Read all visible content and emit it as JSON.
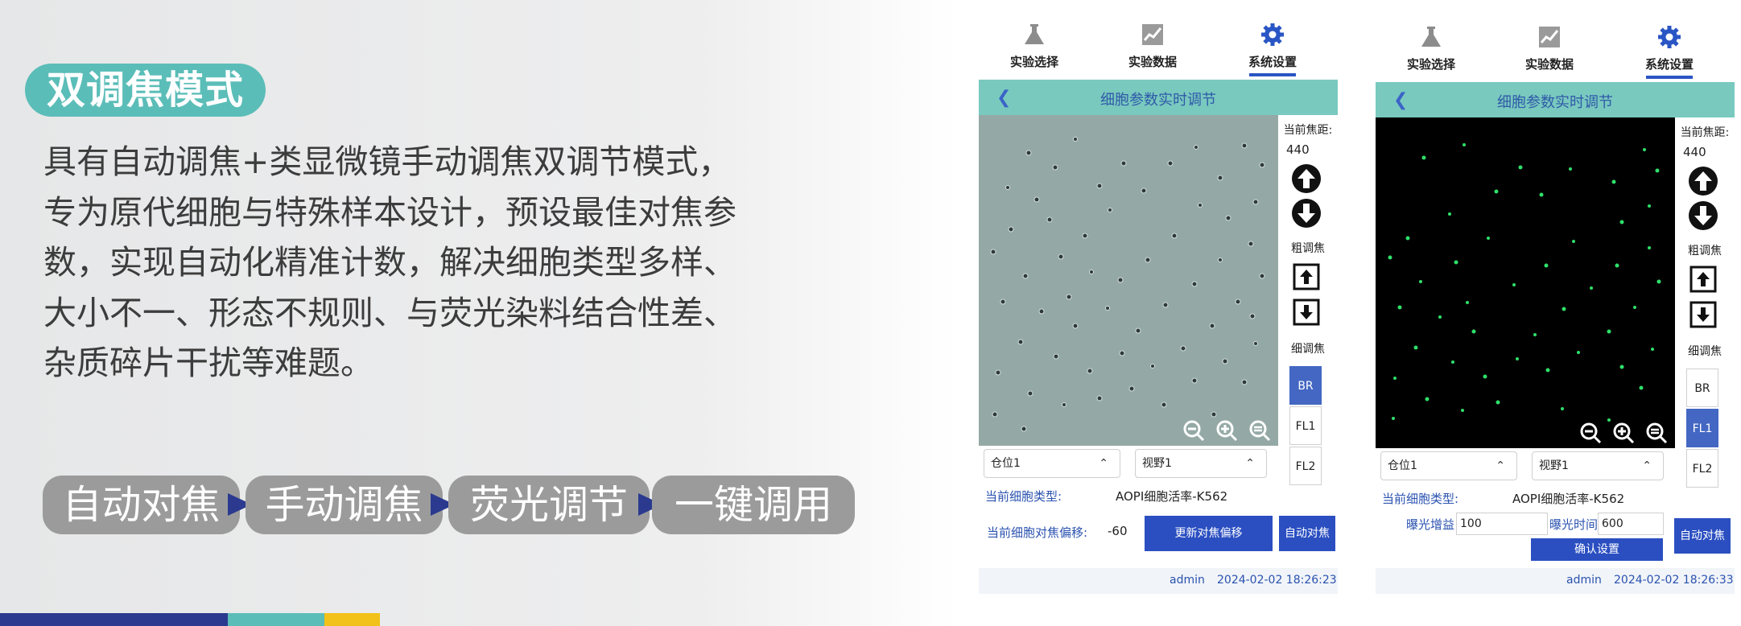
{
  "promo": {
    "mode_title": "双调焦模式",
    "description_lines": [
      "具有自动调焦+类显微镜手动调焦双调节模式，",
      "专为原代细胞与特殊样本设计，预设最佳对焦参",
      "数，实现自动化精准计数，解决细胞类型多样、",
      "大小不一、形态不规则、与荧光染料结合性差、",
      "杂质碎片干扰等难题。"
    ],
    "features": [
      "自动对焦",
      "手动调焦",
      "荧光调节",
      "一键调用"
    ],
    "colors": {
      "teal": "#5bbdb8",
      "navy": "#2b3a8f",
      "gray_pill": "#9b9b9b",
      "yellow": "#f2c11a"
    }
  },
  "nav": {
    "items": [
      {
        "label": "实验选择",
        "icon": "flask-icon"
      },
      {
        "label": "实验数据",
        "icon": "chart-icon"
      },
      {
        "label": "系统设置",
        "icon": "gear-icon",
        "active": true
      }
    ]
  },
  "screen_brightfield": {
    "header_title": "细胞参数实时调节",
    "focus_label": "当前焦距:",
    "focus_value": "440",
    "coarse_label": "粗调焦",
    "fine_label": "细调焦",
    "channels": [
      {
        "label": "BR",
        "active": true
      },
      {
        "label": "FL1",
        "active": false
      },
      {
        "label": "FL2",
        "active": false
      }
    ],
    "slot_select": "仓位1",
    "view_select": "视野1",
    "cell_type_label": "当前细胞类型:",
    "cell_type_value": "AOPI细胞活率-K562",
    "offset_label": "当前细胞对焦偏移:",
    "offset_value": "-60",
    "update_offset_button": "更新对焦偏移",
    "autofocus_button": "自动对焦",
    "user": "admin",
    "timestamp": "2024-02-02 18:26:23"
  },
  "screen_fluorescence": {
    "header_title": "细胞参数实时调节",
    "focus_label": "当前焦距:",
    "focus_value": "440",
    "coarse_label": "粗调焦",
    "fine_label": "细调焦",
    "channels": [
      {
        "label": "BR",
        "active": false
      },
      {
        "label": "FL1",
        "active": true
      },
      {
        "label": "FL2",
        "active": false
      }
    ],
    "slot_select": "仓位1",
    "view_select": "视野1",
    "cell_type_label": "当前细胞类型:",
    "cell_type_value": "AOPI细胞活率-K562",
    "gain_label": "曝光增益",
    "gain_value": "100",
    "exposure_label": "曝光时间",
    "exposure_value": "600",
    "confirm_button": "确认设置",
    "autofocus_button": "自动对焦",
    "user": "admin",
    "timestamp": "2024-02-02 18:26:33"
  }
}
